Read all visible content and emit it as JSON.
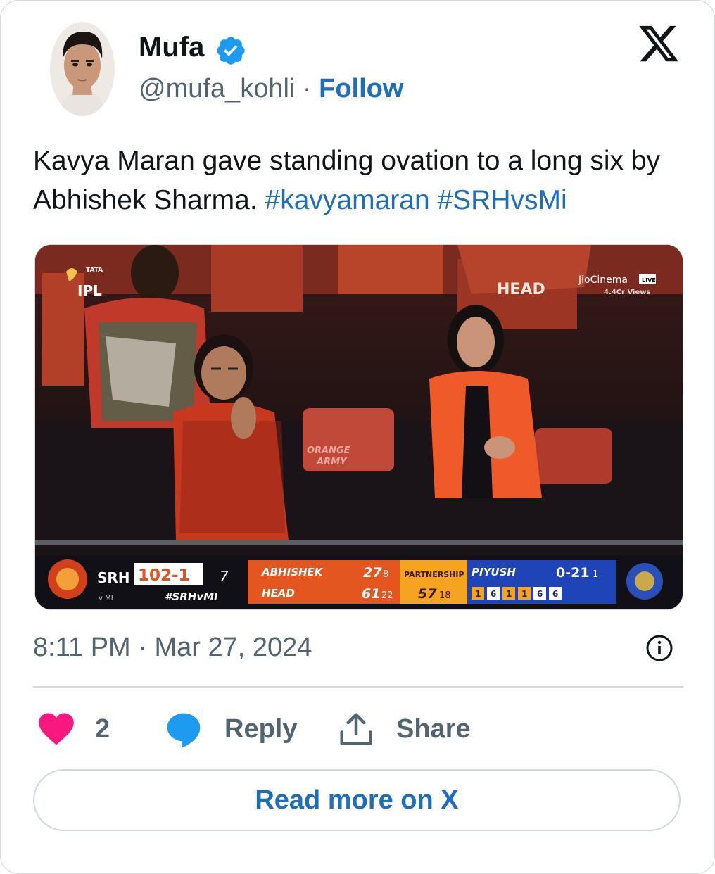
{
  "author": {
    "name": "Mufa",
    "handle": "@mufa_kohli",
    "separator": "·",
    "follow_label": "Follow",
    "verified": true
  },
  "tweet": {
    "text_plain": "Kavya Maran gave standing ovation to a long six by Abhishek Sharma.",
    "hashtags": [
      "#kavyamaran",
      "#SRHvsMi"
    ],
    "timestamp": "8:11 PM · Mar 27, 2024"
  },
  "media": {
    "broadcaster": "JioCinema",
    "live_badge": "LIVE",
    "views": "4.4Cr Views",
    "league_top": "TATA",
    "league": "IPL",
    "crowd_sign": [
      "ORANGE",
      "ARMY"
    ],
    "jersey_text": "HEAD",
    "scoreboard": {
      "team": "SRH",
      "score": "102-1",
      "overs": "7",
      "vs": "v MI",
      "tag": "#SRHvMI",
      "batter1": {
        "name": "ABHISHEK",
        "runs": "27",
        "balls": "8"
      },
      "batter2": {
        "name": "HEAD",
        "runs": "61",
        "balls": "22"
      },
      "partnership_label": "PARTNERSHIP",
      "partnership_runs": "57",
      "partnership_balls": "18",
      "bowler": {
        "name": "PIYUSH",
        "figures": "0-21",
        "overs": "1"
      },
      "balls_this_over": [
        "1",
        "6",
        "1",
        "1",
        "6",
        "6"
      ]
    }
  },
  "actions": {
    "likes": "2",
    "reply_label": "Reply",
    "share_label": "Share",
    "read_more": "Read more on X"
  },
  "colors": {
    "link": "#1d6fbd",
    "heart": "#f91880",
    "reply_bubble": "#1d9bf0",
    "srh_orange": "#f26522"
  }
}
